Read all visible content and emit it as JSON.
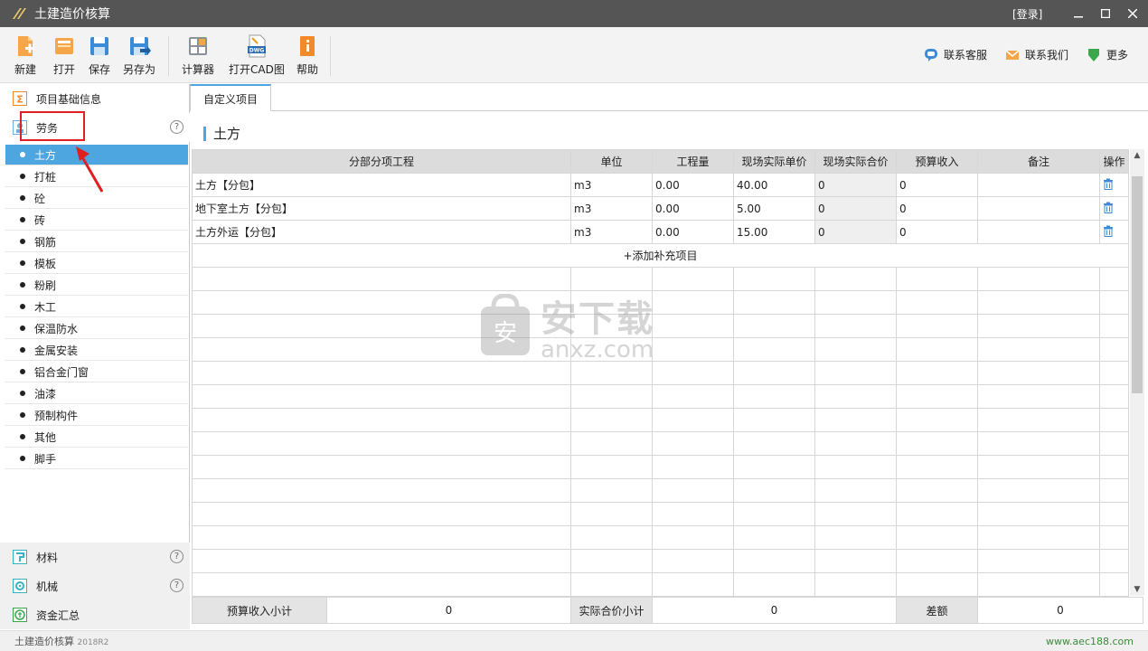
{
  "window": {
    "title": "土建造价核算",
    "login": "[登录]"
  },
  "toolbar": {
    "new": "新建",
    "open": "打开",
    "save": "保存",
    "save_as": "另存为",
    "calculator": "计算器",
    "open_cad": "打开CAD图",
    "help": "帮助",
    "dwg_badge": "DWG",
    "contact_service": "联系客服",
    "contact_us": "联系我们",
    "more": "更多"
  },
  "sidebar": {
    "basic_info": "项目基础信息",
    "labor": "劳务",
    "labor_items": [
      "土方",
      "打桩",
      "砼",
      "砖",
      "钢筋",
      "模板",
      "粉刷",
      "木工",
      "保温防水",
      "金属安装",
      "铝合金门窗",
      "油漆",
      "预制构件",
      "其他",
      "脚手"
    ],
    "materials": "材料",
    "machinery": "机械",
    "fund_summary": "资金汇总",
    "help_mark": "?"
  },
  "content": {
    "tab": "自定义项目",
    "section_title": "土方",
    "columns": [
      "分部分项工程",
      "单位",
      "工程量",
      "现场实际单价",
      "现场实际合价",
      "预算收入",
      "备注",
      "操作"
    ],
    "rows": [
      {
        "name": "土方【分包】",
        "unit": "m3",
        "qty": "0.00",
        "unit_price": "40.00",
        "total": "0",
        "budget": "0",
        "note": ""
      },
      {
        "name": "地下室土方【分包】",
        "unit": "m3",
        "qty": "0.00",
        "unit_price": "5.00",
        "total": "0",
        "budget": "0",
        "note": ""
      },
      {
        "name": "土方外运【分包】",
        "unit": "m3",
        "qty": "0.00",
        "unit_price": "15.00",
        "total": "0",
        "budget": "0",
        "note": ""
      }
    ],
    "add_row": "+添加补充项目"
  },
  "summary": {
    "budget_subtotal_label": "预算收入小计",
    "budget_subtotal": "0",
    "actual_subtotal_label": "实际合价小计",
    "actual_subtotal": "0",
    "diff_label": "差额",
    "diff": "0"
  },
  "status": {
    "app": "土建造价核算",
    "version": "2018R2",
    "site": "www.aec188.com"
  },
  "watermark": {
    "big": "安下载",
    "small": "anxz.com",
    "shield_char": "安"
  },
  "colors": {
    "accent": "#4da6e0",
    "titlebar": "#555555",
    "highlight": "#e02020"
  }
}
